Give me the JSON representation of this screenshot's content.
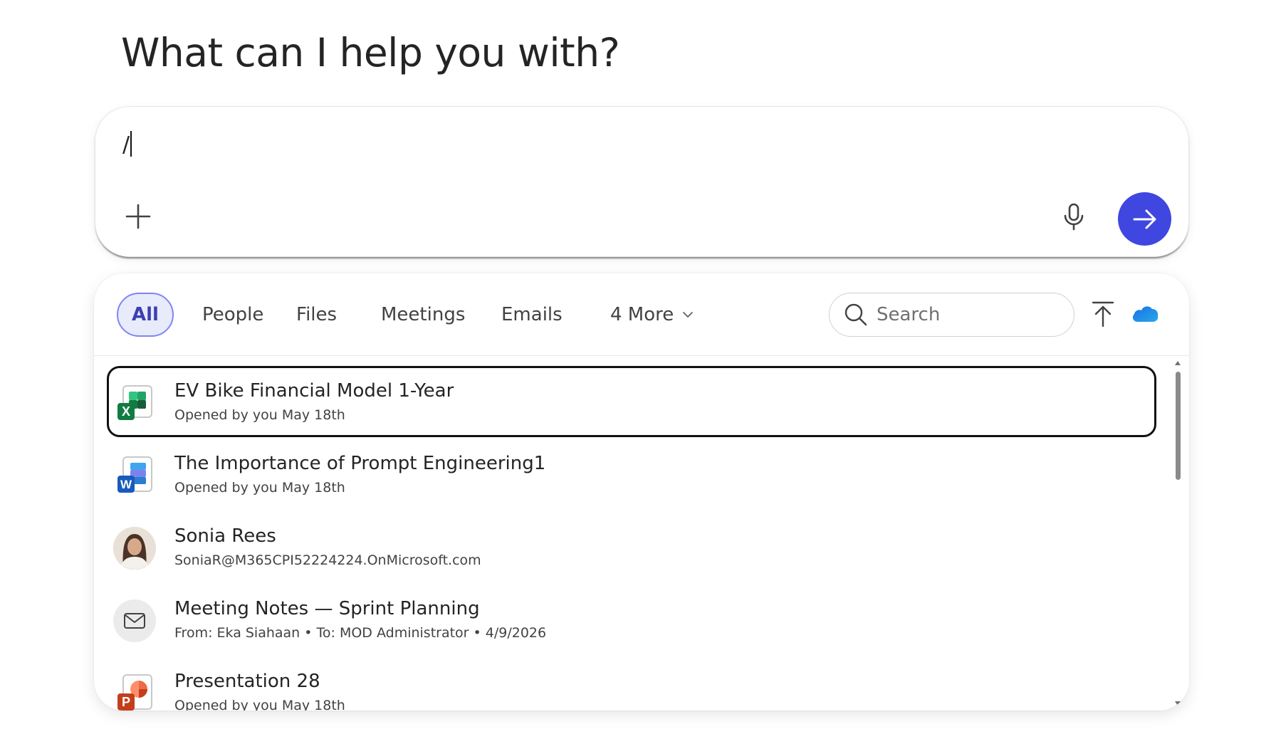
{
  "heading": "What can I help you with?",
  "composer": {
    "value": "/",
    "add_icon": "plus-icon",
    "mic_icon": "microphone-icon",
    "send_icon": "arrow-right-icon",
    "send_color": "#3f47e0"
  },
  "filters": {
    "tabs": [
      {
        "label": "All",
        "active": true
      },
      {
        "label": "People",
        "active": false
      },
      {
        "label": "Files",
        "active": false
      },
      {
        "label": "Meetings",
        "active": false
      },
      {
        "label": "Emails",
        "active": false
      },
      {
        "label": "4 More",
        "active": false
      }
    ],
    "search_placeholder": "Search",
    "upload_icon": "upload-icon",
    "cloud_icon": "onedrive-icon",
    "accent": "#3d3fb3"
  },
  "results": [
    {
      "title": "EV Bike Financial Model 1-Year",
      "subtitle": "Opened by you May 18th",
      "type": "excel",
      "focused": true
    },
    {
      "title": "The Importance of Prompt Engineering1",
      "subtitle": "Opened by you May 18th",
      "type": "word",
      "focused": false
    },
    {
      "title": "Sonia Rees",
      "subtitle": "SoniaR@M365CPI52224224.OnMicrosoft.com",
      "type": "person",
      "focused": false
    },
    {
      "title": "Meeting Notes — Sprint Planning",
      "subtitle": "From: Eka Siahaan • To: MOD Administrator • 4/9/2026",
      "type": "email",
      "focused": false
    },
    {
      "title": "Presentation 28",
      "subtitle": "Opened by you May 18th",
      "type": "powerpoint",
      "focused": false
    }
  ],
  "file_badges": {
    "excel": "X",
    "word": "W",
    "powerpoint": "P"
  }
}
